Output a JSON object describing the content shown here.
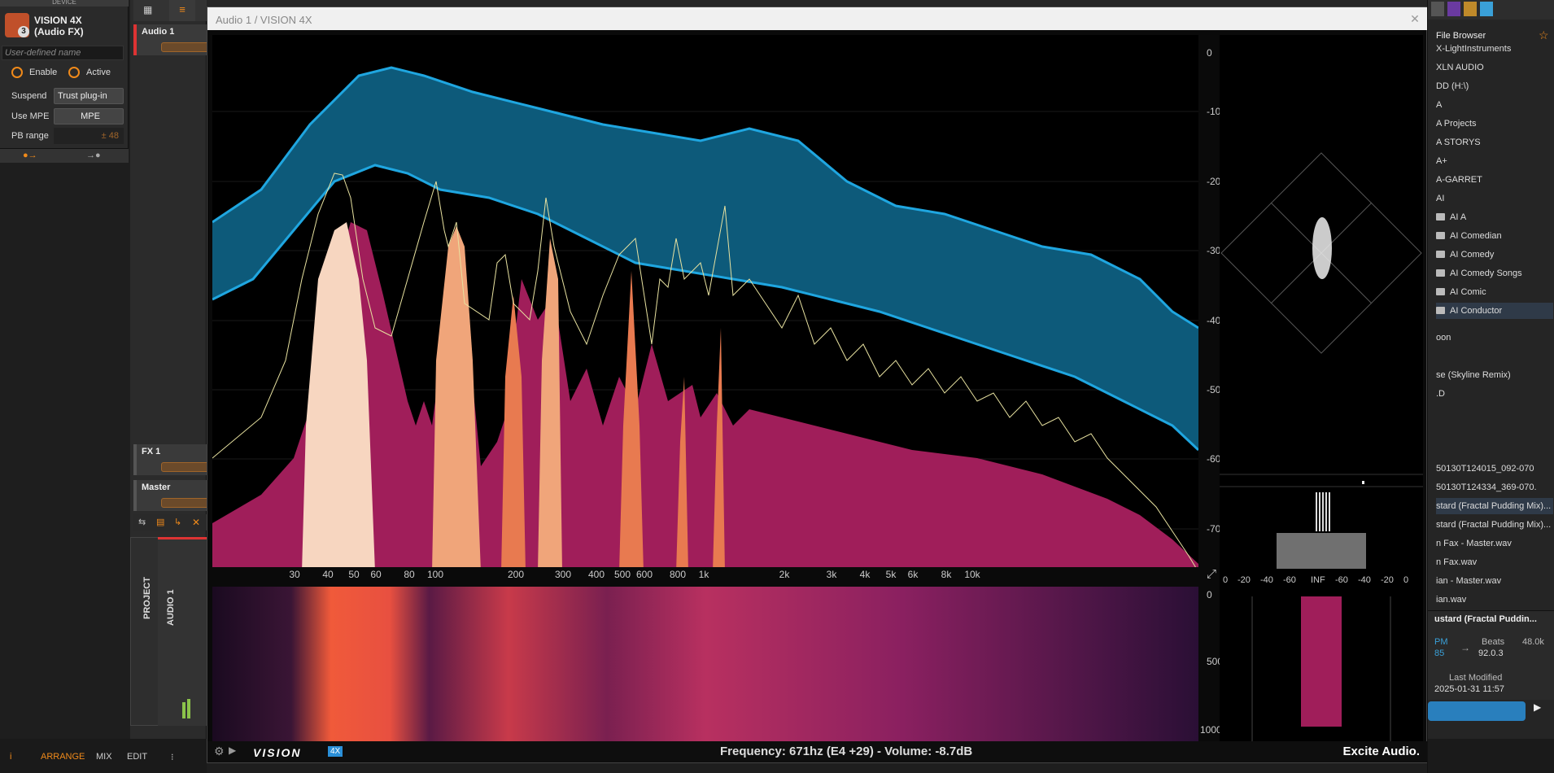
{
  "device": {
    "header": "DEVICE",
    "plugin_name_line1": "VISION 4X",
    "plugin_name_line2": "(Audio FX)",
    "badge": "3",
    "user_name_placeholder": "User-defined name",
    "enable_label": "Enable",
    "active_label": "Active",
    "suspend_label": "Suspend",
    "suspend_value": "Trust plug-in",
    "mpe_label": "Use MPE",
    "mpe_value": "MPE",
    "pb_label": "PB range",
    "pb_value": "± 48"
  },
  "tracks": [
    {
      "name": "Audio 1"
    },
    {
      "name": "FX 1"
    },
    {
      "name": "Master"
    }
  ],
  "mixer_strips": {
    "project": "PROJECT",
    "audio1": "AUDIO 1"
  },
  "global_bar": {
    "arrange": "ARRANGE",
    "mix": "MIX",
    "edit": "EDIT"
  },
  "window": {
    "title": "Audio 1 / VISION 4X",
    "status": "Frequency: 671hz (E4 +29)  - Volume: -8.7dB",
    "brand": "Excite Audio.",
    "logo": "VISION",
    "logo_badge": "4X"
  },
  "spectrum": {
    "freq_ticks": [
      "30",
      "40",
      "50",
      "60",
      "80",
      "100",
      "200",
      "300",
      "400",
      "500",
      "600",
      "800",
      "1k",
      "2k",
      "3k",
      "4k",
      "5k",
      "6k",
      "8k",
      "10k"
    ],
    "db_ticks": [
      "0",
      "-10",
      "-20",
      "-30",
      "-40",
      "-50",
      "-60",
      "-70"
    ],
    "sono_ticks": [
      "0",
      "500",
      "1000"
    ],
    "meter_ticks": [
      "0",
      "-20",
      "-40",
      "-60",
      "INF",
      "-60",
      "-40",
      "-20",
      "0"
    ],
    "colors": {
      "band": "#0d5a7a",
      "band_line": "#1fa6e0",
      "fill": "#a01e5a",
      "peak_line": "#e8e2a0"
    }
  },
  "file_browser": {
    "title": "File Browser",
    "items": [
      {
        "label": "X-LightInstruments",
        "folder": false
      },
      {
        "label": "XLN AUDIO",
        "folder": false
      },
      {
        "label": "DD (H:\\)",
        "folder": false
      },
      {
        "label": "A",
        "folder": false
      },
      {
        "label": "A Projects",
        "folder": false
      },
      {
        "label": "A STORYS",
        "folder": false
      },
      {
        "label": "A+",
        "folder": false
      },
      {
        "label": "A-GARRET",
        "folder": false
      },
      {
        "label": "AI",
        "folder": false
      },
      {
        "label": "AI A",
        "folder": true
      },
      {
        "label": "AI Comedian",
        "folder": true
      },
      {
        "label": "AI Comedy",
        "folder": true
      },
      {
        "label": "AI Comedy Songs",
        "folder": true
      },
      {
        "label": "AI Comic",
        "folder": true
      },
      {
        "label": "AI Conductor",
        "folder": true,
        "selected": true
      }
    ],
    "files": [
      "oon",
      "se (Skyline Remix)",
      ".D",
      "50130T124015_092-070",
      "50130T124334_369-070.",
      "stard (Fractal Pudding Mix)...",
      "stard (Fractal Pudding Mix)...",
      "n Fax - Master.wav",
      "n Fax.wav",
      "ian - Master.wav",
      "ian.wav"
    ],
    "preview_title": "ustard (Fractal Puddin...",
    "bpm_label": "PM",
    "bpm_value": "85",
    "beats_label": "Beats",
    "beats_value": "92.0.3",
    "rate": "48.0k",
    "modified_label": "Last Modified",
    "modified_value": "2025-01-31 11:57"
  }
}
